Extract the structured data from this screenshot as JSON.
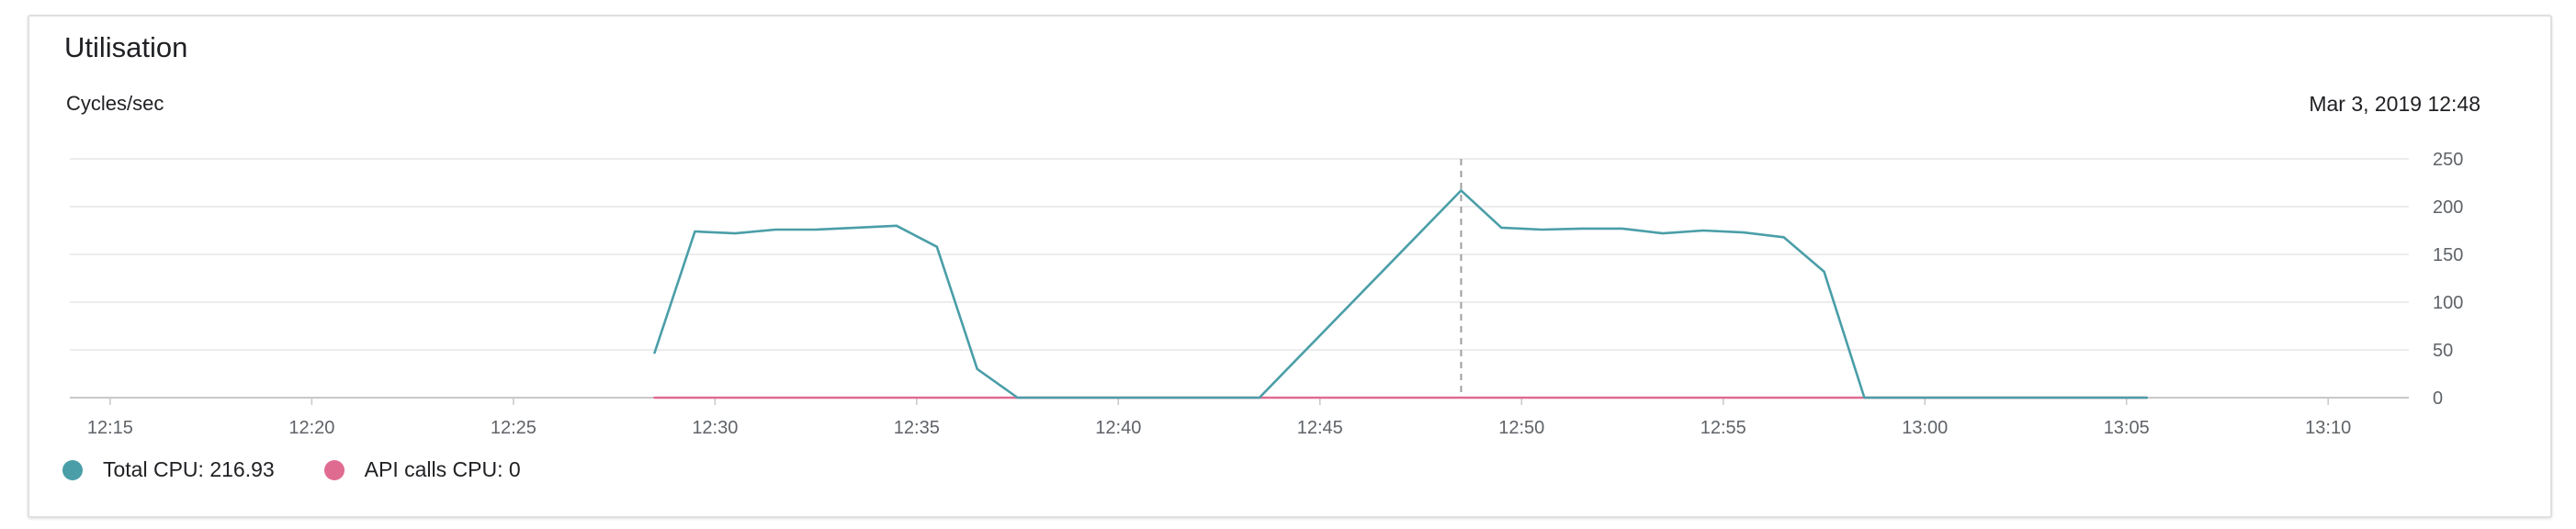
{
  "card": {
    "title": "Utilisation",
    "unit_label": "Cycles/sec",
    "timestamp": "Mar 3, 2019 12:48"
  },
  "legend": [
    {
      "label": "Total CPU: 216.93",
      "color": "#4a9ea8"
    },
    {
      "label": "API calls CPU: 0",
      "color": "#e06b91"
    }
  ],
  "chart_data": {
    "type": "line",
    "ylabel": "Cycles/sec",
    "ylim": [
      0,
      250
    ],
    "yticks": [
      "0",
      "50",
      "100",
      "150",
      "200",
      "250"
    ],
    "xlim": [
      "12:14",
      "13:12"
    ],
    "xticks": [
      "12:15",
      "12:20",
      "12:25",
      "12:30",
      "12:35",
      "12:40",
      "12:45",
      "12:50",
      "12:55",
      "13:00",
      "13:05",
      "13:10"
    ],
    "grid": true,
    "legend_position": "bottom-left",
    "cursor_time": "12:48.5",
    "series": [
      {
        "name": "Total CPU",
        "color": "#4a9ea8",
        "x": [
          "12:28.5",
          "12:29.5",
          "12:30.5",
          "12:31.5",
          "12:32.5",
          "12:33.5",
          "12:34.5",
          "12:35.5",
          "12:36.5",
          "12:37.5",
          "12:38.5",
          "12:39.5",
          "12:40.5",
          "12:41.5",
          "12:42.5",
          "12:43.5",
          "12:48.5",
          "12:49.5",
          "12:50.5",
          "12:51.5",
          "12:52.5",
          "12:53.5",
          "12:54.5",
          "12:55.5",
          "12:56.5",
          "12:57.5",
          "12:58.5",
          "12:59.5",
          "13:00.5",
          "13:01.5",
          "13:02.5",
          "13:03.5",
          "13:04.5",
          "13:05.5"
        ],
        "values": [
          47,
          174,
          172,
          176,
          176,
          178,
          180,
          158,
          30,
          0,
          0,
          0,
          0,
          0,
          0,
          0,
          216.93,
          178,
          176,
          177,
          177,
          172,
          175,
          173,
          168,
          132,
          0,
          0,
          0,
          0,
          0,
          0,
          0,
          0
        ]
      },
      {
        "name": "API calls CPU",
        "color": "#e06b91",
        "x": [
          "12:28.5",
          "13:05.5"
        ],
        "values": [
          0,
          0
        ]
      }
    ]
  }
}
